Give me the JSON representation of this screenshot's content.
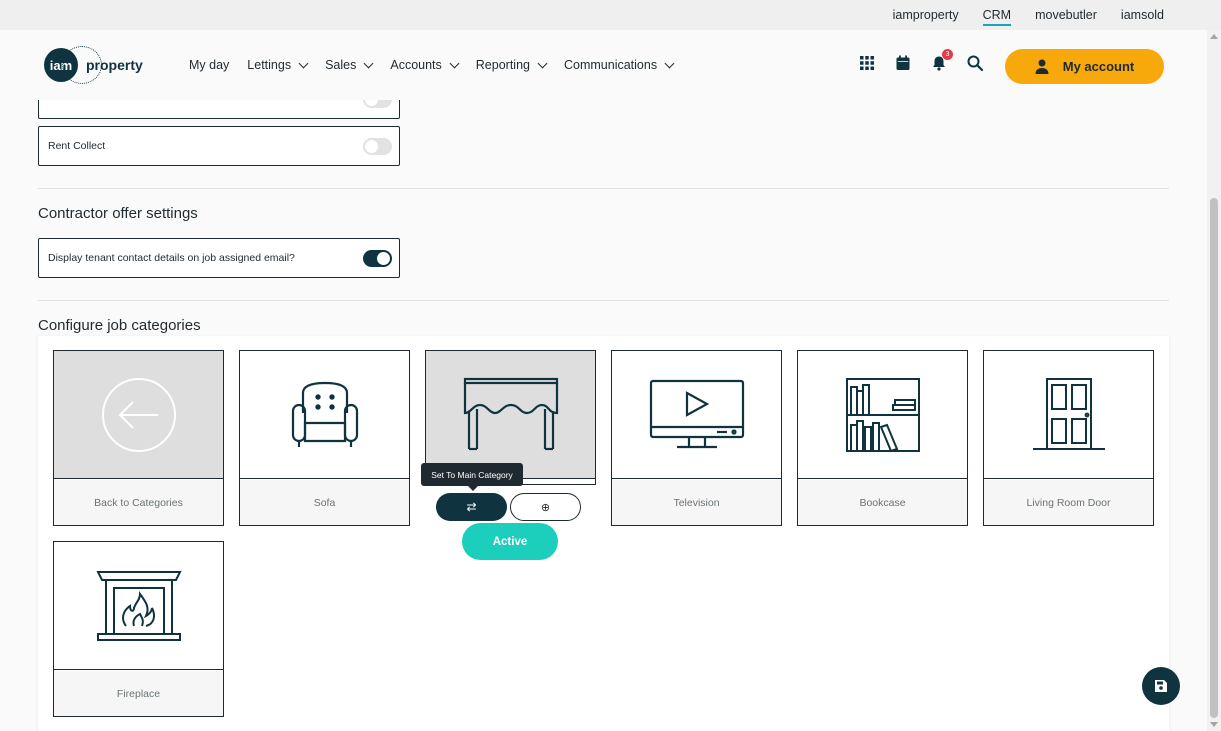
{
  "top_links": [
    {
      "label": "iamproperty",
      "active": false
    },
    {
      "label": "CRM",
      "active": true
    },
    {
      "label": "movebutler",
      "active": false
    },
    {
      "label": "iamsold",
      "active": false
    }
  ],
  "logo": {
    "mark": "iam",
    "word": "property"
  },
  "nav": [
    {
      "label": "My day",
      "dropdown": false
    },
    {
      "label": "Lettings",
      "dropdown": true
    },
    {
      "label": "Sales",
      "dropdown": true
    },
    {
      "label": "Accounts",
      "dropdown": true
    },
    {
      "label": "Reporting",
      "dropdown": true
    },
    {
      "label": "Communications",
      "dropdown": true
    }
  ],
  "header_icons": {
    "apps": "grid-icon",
    "calendar": "calendar-icon",
    "notifications": "bell-icon",
    "notification_count": "3",
    "search": "search-icon"
  },
  "account_button": {
    "label": "My account",
    "icon": "user-icon"
  },
  "settings": {
    "rent_collect": {
      "label": "Rent Collect",
      "enabled": false
    },
    "contractor_title": "Contractor offer settings",
    "display_tenant": {
      "label": "Display tenant contact details on job assigned email?",
      "enabled": true
    },
    "job_categories_title": "Configure job categories"
  },
  "categories": [
    {
      "label": "Back to Categories",
      "icon": "back-arrow-icon",
      "grey": true
    },
    {
      "label": "Sofa",
      "icon": "armchair-icon",
      "grey": false
    },
    {
      "label": "",
      "icon": "curtain-pelmet-icon",
      "grey": true
    },
    {
      "label": "Television",
      "icon": "television-icon",
      "grey": false
    },
    {
      "label": "Bookcase",
      "icon": "bookcase-icon",
      "grey": false
    },
    {
      "label": "Living Room Door",
      "icon": "door-icon",
      "grey": false
    },
    {
      "label": "Fireplace",
      "icon": "fireplace-icon",
      "grey": false
    }
  ],
  "hover_actions": {
    "tooltip": "Set To Main Category",
    "swap_icon": "⇄",
    "add_icon": "⊕",
    "status": "Active"
  },
  "colors": {
    "primary": "#0f3440",
    "accent": "#f7a90b",
    "active": "#1ccfbd",
    "badge": "#e03c4a"
  }
}
